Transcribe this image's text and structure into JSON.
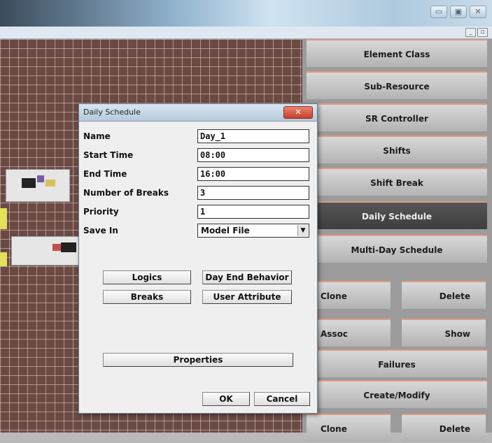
{
  "window": {
    "minimize_glyph": "▭",
    "maximize_glyph": "▣",
    "close_glyph": "✕",
    "mdi_minimize_glyph": "_",
    "mdi_maximize_glyph": "▫"
  },
  "panel": {
    "element_class": "Element Class",
    "sub_resource": "Sub-Resource",
    "sr_controller": "SR Controller",
    "shifts": "Shifts",
    "shift_break": "Shift Break",
    "daily_schedule": "Daily Schedule",
    "multi_day_schedule": "Multi-Day Schedule",
    "clone_1": "Clone",
    "delete_1": "Delete",
    "assoc": "Assoc",
    "show": "Show",
    "failures": "Failures",
    "create_modify": "Create/Modify",
    "clone_2": "Clone",
    "delete_2": "Delete"
  },
  "dialog": {
    "title": "Daily Schedule",
    "close_glyph": "✕",
    "fields": {
      "name_label": "Name",
      "name_value": "Day_1",
      "start_label": "Start Time",
      "start_value": "08:00",
      "end_label": "End Time",
      "end_value": "16:00",
      "breaks_label": "Number of Breaks",
      "breaks_value": "3",
      "priority_label": "Priority",
      "priority_value": "1",
      "save_label": "Save In",
      "save_value": "Model File",
      "dropdown_glyph": "▼"
    },
    "buttons": {
      "logics": "Logics",
      "day_end": "Day End Behavior",
      "breaks": "Breaks",
      "user_attribute": "User Attribute",
      "properties": "Properties",
      "ok": "OK",
      "cancel": "Cancel"
    }
  }
}
